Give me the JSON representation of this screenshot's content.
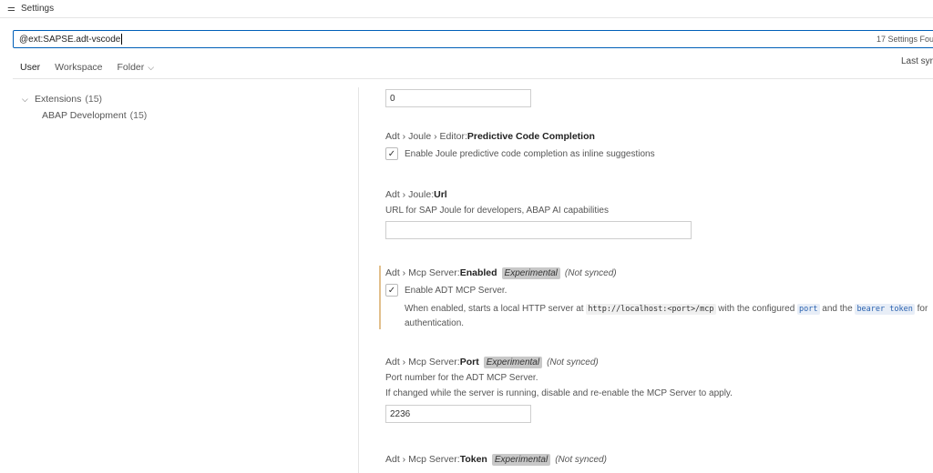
{
  "titlebar": {
    "icon": "settings-sliders-icon",
    "title": "Settings"
  },
  "search": {
    "value": "@ext:SAPSE.adt-vscode",
    "count": "17 Settings Fou"
  },
  "tabs": {
    "user": "User",
    "workspace": "Workspace",
    "folder": "Folder"
  },
  "sync_label": "Last syr",
  "toc": {
    "extensions": {
      "label": "Extensions",
      "count": "(15)"
    },
    "abap": {
      "label": "ABAP Development",
      "count": "(15)"
    }
  },
  "settings": {
    "top_input": {
      "value": "0"
    },
    "predictive": {
      "category": "Adt › Joule › Editor: ",
      "name": "Predictive Code Completion",
      "checkbox_label": "Enable Joule predictive code completion as inline suggestions"
    },
    "url": {
      "category": "Adt › Joule: ",
      "name": "Url",
      "description": "URL for SAP Joule for developers, ABAP AI capabilities",
      "value": ""
    },
    "mcp_enabled": {
      "category": "Adt › Mcp Server: ",
      "name": "Enabled",
      "tag": "Experimental",
      "not_synced": "(Not synced)",
      "checkbox_label": "Enable ADT MCP Server.",
      "desc_1": "When enabled, starts a local HTTP server at ",
      "code_url": "http://localhost:<port>/mcp",
      "desc_2": " with the configured ",
      "code_port": "port",
      "desc_3": " and the ",
      "code_token": "bearer token",
      "desc_4": " for authentication."
    },
    "mcp_port": {
      "category": "Adt › Mcp Server: ",
      "name": "Port",
      "tag": "Experimental",
      "not_synced": "(Not synced)",
      "description": "Port number for the ADT MCP Server.",
      "description2": "If changed while the server is running, disable and re-enable the MCP Server to apply.",
      "value": "2236"
    },
    "mcp_token": {
      "category": "Adt › Mcp Server: ",
      "name": "Token",
      "tag": "Experimental",
      "not_synced": "(Not synced)"
    }
  }
}
